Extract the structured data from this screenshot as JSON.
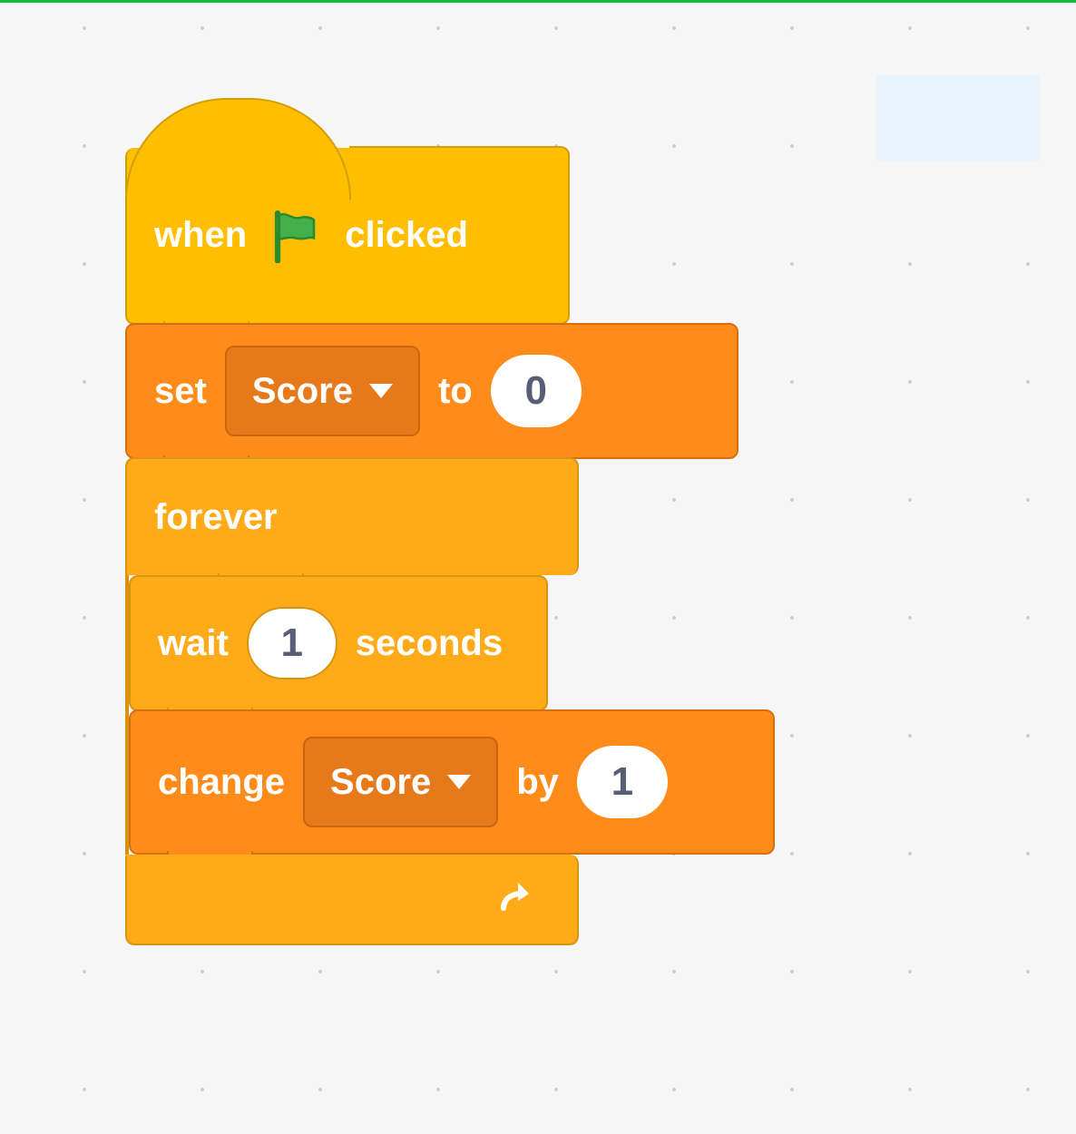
{
  "hat_block": {
    "text_before": "when",
    "text_after": "clicked",
    "icon": "green-flag-icon"
  },
  "set_block": {
    "label_set": "set",
    "dropdown_value": "Score",
    "label_to": "to",
    "input_value": "0"
  },
  "forever_block": {
    "label": "forever"
  },
  "wait_block": {
    "label_wait": "wait",
    "input_value": "1",
    "label_seconds": "seconds"
  },
  "change_block": {
    "label_change": "change",
    "dropdown_value": "Score",
    "label_by": "by",
    "input_value": "1"
  },
  "colors": {
    "events": "#ffbf00",
    "variables": "#ff8c1a",
    "control": "#ffab19",
    "flag": "#43b04a"
  }
}
